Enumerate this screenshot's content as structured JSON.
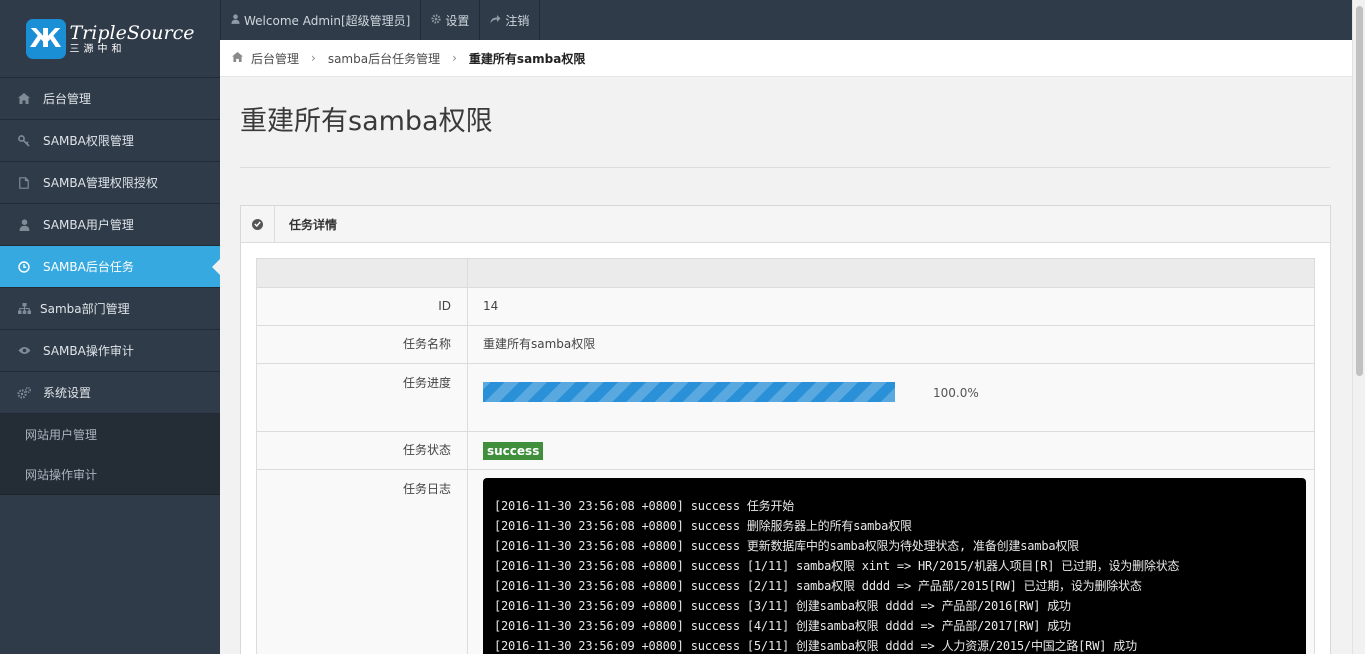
{
  "logo": {
    "mark": "Ж",
    "en": "TripleSource",
    "cn": "三源中和"
  },
  "topbar": [
    {
      "icon": "user-icon",
      "label": "Welcome Admin[超级管理员]"
    },
    {
      "icon": "gear-icon",
      "label": "设置"
    },
    {
      "icon": "logout-icon",
      "label": "注销"
    }
  ],
  "breadcrumb": {
    "home": "后台管理",
    "parent": "samba后台任务管理",
    "current": "重建所有samba权限"
  },
  "sidebar": {
    "items": [
      {
        "label": "后台管理",
        "icon": "home-icon"
      },
      {
        "label": "SAMBA权限管理",
        "icon": "key-icon"
      },
      {
        "label": "SAMBA管理权限授权",
        "icon": "file-icon"
      },
      {
        "label": "SAMBA用户管理",
        "icon": "user-icon"
      },
      {
        "label": "SAMBA后台任务",
        "icon": "clock-icon",
        "active": true
      },
      {
        "label": "Samba部门管理",
        "icon": "sitemap-icon"
      },
      {
        "label": "SAMBA操作审计",
        "icon": "eye-icon"
      },
      {
        "label": "系统设置",
        "icon": "gears-icon"
      }
    ],
    "sub_items": [
      {
        "label": "网站用户管理"
      },
      {
        "label": "网站操作审计"
      }
    ]
  },
  "page": {
    "title": "重建所有samba权限"
  },
  "panel": {
    "title": "任务详情",
    "id_label": "ID",
    "id_value": "14",
    "name_label": "任务名称",
    "name_value": "重建所有samba权限",
    "progress_label": "任务进度",
    "progress_value": 1.0,
    "progress_text": "100.0%",
    "status_label": "任务状态",
    "status_value": "success",
    "status_color": "#3f8f3d",
    "log_label": "任务日志",
    "log": [
      "[2016-11-30 23:56:08 +0800] success 任务开始",
      "[2016-11-30 23:56:08 +0800] success 删除服务器上的所有samba权限",
      "[2016-11-30 23:56:08 +0800] success 更新数据库中的samba权限为待处理状态, 准备创建samba权限",
      "[2016-11-30 23:56:08 +0800] success [1/11] samba权限 xint => HR/2015/机器人项目[R] 已过期，设为删除状态",
      "[2016-11-30 23:56:08 +0800] success [2/11] samba权限 dddd => 产品部/2015[RW] 已过期，设为删除状态",
      "[2016-11-30 23:56:09 +0800] success [3/11] 创建samba权限 dddd => 产品部/2016[RW] 成功",
      "[2016-11-30 23:56:09 +0800] success [4/11] 创建samba权限 dddd => 产品部/2017[RW] 成功",
      "[2016-11-30 23:56:09 +0800] success [5/11] 创建samba权限 dddd => 人力资源/2015/中国之路[RW] 成功"
    ]
  },
  "colors": {
    "sidebar_bg": "#2f3b48",
    "accent": "#36a9e0",
    "progress": "#2a91d8"
  }
}
